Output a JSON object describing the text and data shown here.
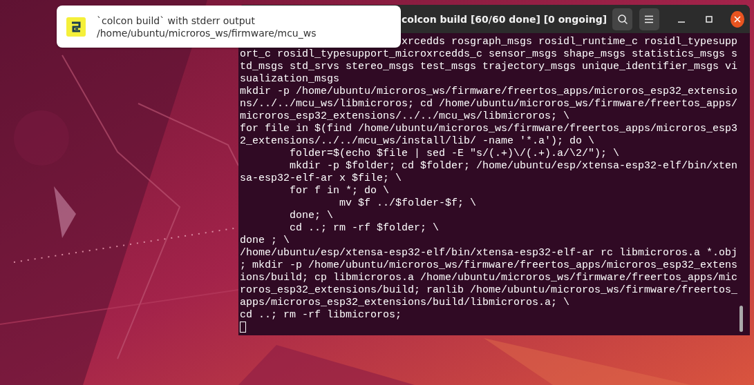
{
  "notification": {
    "title": "`colcon build` with stderr output",
    "body": "/home/ubuntu/microros_ws/firmware/mcu_ws"
  },
  "terminal": {
    "title": "colcon build [60/60 done] [0 ongoing]",
    "lines": [
      "xrcedds rosgraph_msgs rosidl_runtime_c rosidl_typesupp",
      "ort_c rosidl_typesupport_microxrcedds_c sensor_msgs shape_msgs statistics_msgs s",
      "td_msgs std_srvs stereo_msgs test_msgs trajectory_msgs unique_identifier_msgs vi",
      "sualization_msgs",
      "mkdir -p /home/ubuntu/microros_ws/firmware/freertos_apps/microros_esp32_extensio",
      "ns/../../mcu_ws/libmicroros; cd /home/ubuntu/microros_ws/firmware/freertos_apps/",
      "microros_esp32_extensions/../../mcu_ws/libmicroros; \\",
      "for file in $(find /home/ubuntu/microros_ws/firmware/freertos_apps/microros_esp3",
      "2_extensions/../../mcu_ws/install/lib/ -name '*.a'); do \\",
      "        folder=$(echo $file | sed -E \"s/(.+)\\/(.+).a/\\2/\"); \\",
      "        mkdir -p $folder; cd $folder; /home/ubuntu/esp/xtensa-esp32-elf/bin/xten",
      "sa-esp32-elf-ar x $file; \\",
      "        for f in *; do \\",
      "                mv $f ../$folder-$f; \\",
      "        done; \\",
      "        cd ..; rm -rf $folder; \\",
      "done ; \\",
      "/home/ubuntu/esp/xtensa-esp32-elf/bin/xtensa-esp32-elf-ar rc libmicroros.a *.obj",
      "; mkdir -p /home/ubuntu/microros_ws/firmware/freertos_apps/microros_esp32_extens",
      "ions/build; cp libmicroros.a /home/ubuntu/microros_ws/firmware/freertos_apps/mic",
      "roros_esp32_extensions/build; ranlib /home/ubuntu/microros_ws/firmware/freertos_",
      "apps/microros_esp32_extensions/build/libmicroros.a; \\",
      "cd ..; rm -rf libmicroros;"
    ]
  }
}
